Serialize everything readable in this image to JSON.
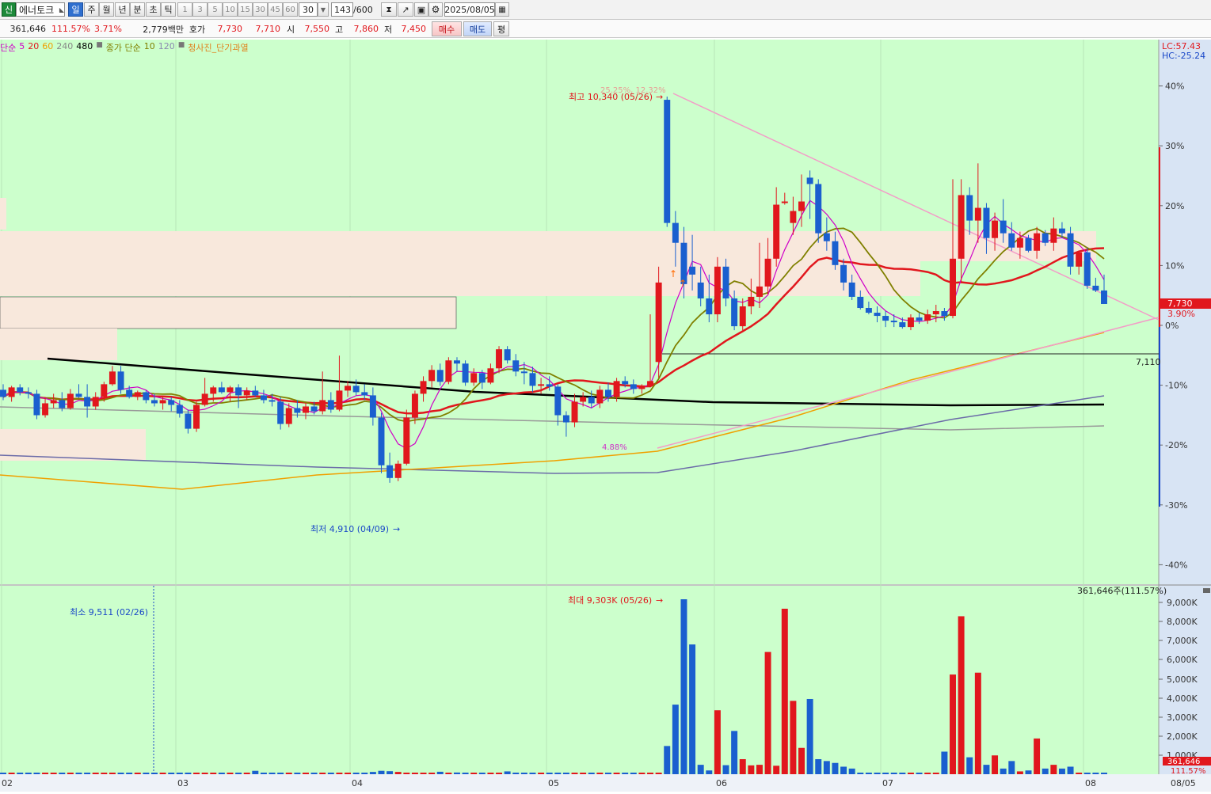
{
  "toolbar": {
    "market_badge": "신",
    "stock_name": "에너토크",
    "periods": [
      "일",
      "주",
      "월",
      "년",
      "분",
      "초",
      "틱"
    ],
    "selected_period": "일",
    "intervals": [
      "1",
      "3",
      "5",
      "10",
      "15",
      "30",
      "45",
      "60"
    ],
    "interval_select": "30",
    "count_value": "143",
    "count_max": "/600",
    "date_value": "2025/08/05"
  },
  "quote": {
    "volume": "361,646",
    "volume_ratio": "111.57%",
    "change_pct": "3.71%",
    "trade_amount": "2,779백만",
    "bid_ask_label": "호가",
    "ask_price": "7,730",
    "bid_price": "7,710",
    "open_label": "시",
    "open": "7,550",
    "high_label": "고",
    "high": "7,860",
    "low_label": "저",
    "low": "7,450",
    "buy_label": "매수",
    "sell_label": "매도",
    "eval_label": "평"
  },
  "indicators": {
    "ma_label": "단순",
    "ma5": "5",
    "ma20": "20",
    "ma60": "60",
    "ma240": "240",
    "ma480": "480",
    "close_ma_label": "종가 단순",
    "close_ma10": "10",
    "close_ma120": "120",
    "signal_label": "청사진_단기과열",
    "colors": {
      "ma5": "#d000c8",
      "ma20": "#e1171d",
      "ma60": "#f0a000",
      "ma240": "#888888",
      "ma480": "#000000",
      "close10": "#808000",
      "close120": "#8a8ab0"
    }
  },
  "chart_data": {
    "type": "candlestick",
    "price_axis": {
      "lc_label": "LC:57.43",
      "hc_label": "HC:-25.24",
      "ticks": [
        "40%",
        "30%",
        "20%",
        "10%",
        "0%",
        "-10%",
        "-20%",
        "-30%",
        "-40%"
      ]
    },
    "x_labels": [
      "02",
      "03",
      "04",
      "05",
      "06",
      "07",
      "08",
      "08/05"
    ],
    "annotations": {
      "highest": "최고 10,340 (05/26)",
      "lowest": "최저 4,910 (04/09)",
      "high_pct": "25.25%, 12.32%",
      "low_pct": "4.88%",
      "support_price": "7,110",
      "current_price": "7,730",
      "current_pct": "3.90%"
    },
    "volume_axis": {
      "ticks": [
        "9,000K",
        "8,000K",
        "7,000K",
        "6,000K",
        "5,000K",
        "4,000K",
        "3,000K",
        "2,000K",
        "1,000K"
      ]
    },
    "volume_annotations": {
      "max": "최대 9,303K (05/26)",
      "min": "최소 9,511 (02/26)",
      "current": "361,646주(111.57%)",
      "current_badge": "361,646",
      "current_pct_badge": "111.57%"
    },
    "candles": [
      {
        "o": 6650,
        "h": 6720,
        "l": 6520,
        "c": 6560
      },
      {
        "o": 6560,
        "h": 6700,
        "l": 6500,
        "c": 6680
      },
      {
        "o": 6680,
        "h": 6720,
        "l": 6580,
        "c": 6620
      },
      {
        "o": 6620,
        "h": 6680,
        "l": 6540,
        "c": 6600
      },
      {
        "o": 6600,
        "h": 6650,
        "l": 6280,
        "c": 6330
      },
      {
        "o": 6330,
        "h": 6560,
        "l": 6300,
        "c": 6480
      },
      {
        "o": 6480,
        "h": 6600,
        "l": 6420,
        "c": 6520
      },
      {
        "o": 6520,
        "h": 6620,
        "l": 6380,
        "c": 6420
      },
      {
        "o": 6420,
        "h": 6660,
        "l": 6400,
        "c": 6600
      },
      {
        "o": 6600,
        "h": 6720,
        "l": 6550,
        "c": 6560
      },
      {
        "o": 6560,
        "h": 6720,
        "l": 6300,
        "c": 6440
      },
      {
        "o": 6440,
        "h": 6620,
        "l": 6400,
        "c": 6560
      },
      {
        "o": 6560,
        "h": 6750,
        "l": 6500,
        "c": 6720
      },
      {
        "o": 6720,
        "h": 6950,
        "l": 6700,
        "c": 6880
      },
      {
        "o": 6880,
        "h": 6950,
        "l": 6600,
        "c": 6650
      },
      {
        "o": 6650,
        "h": 6700,
        "l": 6540,
        "c": 6560
      },
      {
        "o": 6560,
        "h": 6640,
        "l": 6520,
        "c": 6620
      },
      {
        "o": 6620,
        "h": 6640,
        "l": 6480,
        "c": 6520
      },
      {
        "o": 6520,
        "h": 6600,
        "l": 6440,
        "c": 6480
      },
      {
        "o": 6480,
        "h": 6560,
        "l": 6400,
        "c": 6520
      },
      {
        "o": 6520,
        "h": 6560,
        "l": 6380,
        "c": 6460
      },
      {
        "o": 6460,
        "h": 6520,
        "l": 6300,
        "c": 6350
      },
      {
        "o": 6350,
        "h": 6400,
        "l": 6100,
        "c": 6160
      },
      {
        "o": 6160,
        "h": 6500,
        "l": 6120,
        "c": 6460
      },
      {
        "o": 6460,
        "h": 6800,
        "l": 6440,
        "c": 6600
      },
      {
        "o": 6600,
        "h": 6700,
        "l": 6500,
        "c": 6680
      },
      {
        "o": 6680,
        "h": 6750,
        "l": 6600,
        "c": 6620
      },
      {
        "o": 6620,
        "h": 6700,
        "l": 6500,
        "c": 6680
      },
      {
        "o": 6680,
        "h": 6720,
        "l": 6420,
        "c": 6580
      },
      {
        "o": 6580,
        "h": 6680,
        "l": 6520,
        "c": 6640
      },
      {
        "o": 6640,
        "h": 6700,
        "l": 6560,
        "c": 6580
      },
      {
        "o": 6580,
        "h": 6650,
        "l": 6480,
        "c": 6520
      },
      {
        "o": 6520,
        "h": 6600,
        "l": 6440,
        "c": 6500
      },
      {
        "o": 6500,
        "h": 6560,
        "l": 6150,
        "c": 6220
      },
      {
        "o": 6220,
        "h": 6480,
        "l": 6180,
        "c": 6420
      },
      {
        "o": 6420,
        "h": 6520,
        "l": 6300,
        "c": 6360
      },
      {
        "o": 6360,
        "h": 6480,
        "l": 6280,
        "c": 6440
      },
      {
        "o": 6440,
        "h": 6500,
        "l": 6340,
        "c": 6380
      },
      {
        "o": 6380,
        "h": 6880,
        "l": 6340,
        "c": 6520
      },
      {
        "o": 6520,
        "h": 6620,
        "l": 6360,
        "c": 6400
      },
      {
        "o": 6400,
        "h": 7080,
        "l": 6380,
        "c": 6640
      },
      {
        "o": 6640,
        "h": 6760,
        "l": 6560,
        "c": 6700
      },
      {
        "o": 6700,
        "h": 6780,
        "l": 6580,
        "c": 6620
      },
      {
        "o": 6620,
        "h": 6720,
        "l": 6520,
        "c": 6580
      },
      {
        "o": 6580,
        "h": 6680,
        "l": 6200,
        "c": 6300
      },
      {
        "o": 6300,
        "h": 6360,
        "l": 5600,
        "c": 5700
      },
      {
        "o": 5700,
        "h": 5860,
        "l": 5480,
        "c": 5540
      },
      {
        "o": 5540,
        "h": 5760,
        "l": 5500,
        "c": 5720
      },
      {
        "o": 5720,
        "h": 6400,
        "l": 5700,
        "c": 6300
      },
      {
        "o": 6300,
        "h": 6640,
        "l": 6220,
        "c": 6600
      },
      {
        "o": 6600,
        "h": 6820,
        "l": 6500,
        "c": 6760
      },
      {
        "o": 6760,
        "h": 6960,
        "l": 6680,
        "c": 6900
      },
      {
        "o": 6900,
        "h": 6980,
        "l": 6700,
        "c": 6750
      },
      {
        "o": 6750,
        "h": 7060,
        "l": 6720,
        "c": 7020
      },
      {
        "o": 7020,
        "h": 7060,
        "l": 6880,
        "c": 6980
      },
      {
        "o": 6980,
        "h": 7020,
        "l": 6700,
        "c": 6740
      },
      {
        "o": 6740,
        "h": 6920,
        "l": 6700,
        "c": 6860
      },
      {
        "o": 6860,
        "h": 6900,
        "l": 6660,
        "c": 6740
      },
      {
        "o": 6740,
        "h": 6980,
        "l": 6720,
        "c": 6920
      },
      {
        "o": 6920,
        "h": 7200,
        "l": 6860,
        "c": 7160
      },
      {
        "o": 7160,
        "h": 7200,
        "l": 6980,
        "c": 7020
      },
      {
        "o": 7020,
        "h": 7100,
        "l": 6820,
        "c": 6880
      },
      {
        "o": 6880,
        "h": 7000,
        "l": 6720,
        "c": 6860
      },
      {
        "o": 6860,
        "h": 6940,
        "l": 6620,
        "c": 6700
      },
      {
        "o": 6700,
        "h": 6800,
        "l": 6600,
        "c": 6720
      },
      {
        "o": 6720,
        "h": 6820,
        "l": 6640,
        "c": 6690
      },
      {
        "o": 6690,
        "h": 6720,
        "l": 6200,
        "c": 6330
      },
      {
        "o": 6330,
        "h": 6380,
        "l": 6060,
        "c": 6240
      },
      {
        "o": 6240,
        "h": 6600,
        "l": 6180,
        "c": 6500
      },
      {
        "o": 6500,
        "h": 6620,
        "l": 6440,
        "c": 6560
      },
      {
        "o": 6560,
        "h": 6640,
        "l": 6420,
        "c": 6480
      },
      {
        "o": 6480,
        "h": 6700,
        "l": 6420,
        "c": 6650
      },
      {
        "o": 6650,
        "h": 6740,
        "l": 6500,
        "c": 6560
      },
      {
        "o": 6560,
        "h": 6800,
        "l": 6500,
        "c": 6760
      },
      {
        "o": 6760,
        "h": 6820,
        "l": 6680,
        "c": 6720
      },
      {
        "o": 6720,
        "h": 6780,
        "l": 6600,
        "c": 6660
      },
      {
        "o": 6660,
        "h": 6720,
        "l": 6600,
        "c": 6700
      },
      {
        "o": 6700,
        "h": 7600,
        "l": 6680,
        "c": 6760
      },
      {
        "o": 7000,
        "h": 8200,
        "l": 6800,
        "c": 8000
      },
      {
        "o": 10300,
        "h": 10340,
        "l": 8700,
        "c": 8750
      },
      {
        "o": 8750,
        "h": 8900,
        "l": 8200,
        "c": 8500
      },
      {
        "o": 8500,
        "h": 8700,
        "l": 7800,
        "c": 7980
      },
      {
        "o": 8200,
        "h": 8600,
        "l": 7900,
        "c": 8100
      },
      {
        "o": 8000,
        "h": 8200,
        "l": 7700,
        "c": 7800
      },
      {
        "o": 7800,
        "h": 8100,
        "l": 7500,
        "c": 7600
      },
      {
        "o": 7600,
        "h": 8320,
        "l": 7500,
        "c": 8200
      },
      {
        "o": 8200,
        "h": 8300,
        "l": 7700,
        "c": 7800
      },
      {
        "o": 7800,
        "h": 7900,
        "l": 7400,
        "c": 7450
      },
      {
        "o": 7450,
        "h": 7800,
        "l": 7400,
        "c": 7700
      },
      {
        "o": 7700,
        "h": 8050,
        "l": 7600,
        "c": 7820
      },
      {
        "o": 7820,
        "h": 8500,
        "l": 7680,
        "c": 7950
      },
      {
        "o": 7950,
        "h": 8560,
        "l": 7850,
        "c": 8300
      },
      {
        "o": 8300,
        "h": 9200,
        "l": 8200,
        "c": 8980
      },
      {
        "o": 9000,
        "h": 9130,
        "l": 8980,
        "c": 9020
      },
      {
        "o": 8750,
        "h": 9080,
        "l": 8600,
        "c": 8900
      },
      {
        "o": 8900,
        "h": 9360,
        "l": 8700,
        "c": 9020
      },
      {
        "o": 9320,
        "h": 9410,
        "l": 8800,
        "c": 9240
      },
      {
        "o": 9240,
        "h": 9300,
        "l": 8500,
        "c": 8620
      },
      {
        "o": 8620,
        "h": 8820,
        "l": 8400,
        "c": 8520
      },
      {
        "o": 8520,
        "h": 8640,
        "l": 8160,
        "c": 8220
      },
      {
        "o": 8220,
        "h": 8300,
        "l": 7900,
        "c": 8000
      },
      {
        "o": 8000,
        "h": 8100,
        "l": 7780,
        "c": 7820
      },
      {
        "o": 7820,
        "h": 7900,
        "l": 7660,
        "c": 7680
      },
      {
        "o": 7680,
        "h": 7760,
        "l": 7600,
        "c": 7620
      },
      {
        "o": 7620,
        "h": 7700,
        "l": 7500,
        "c": 7580
      },
      {
        "o": 7580,
        "h": 7640,
        "l": 7440,
        "c": 7520
      },
      {
        "o": 7520,
        "h": 7600,
        "l": 7440,
        "c": 7500
      },
      {
        "o": 7500,
        "h": 7560,
        "l": 7420,
        "c": 7440
      },
      {
        "o": 7440,
        "h": 7600,
        "l": 7400,
        "c": 7560
      },
      {
        "o": 7560,
        "h": 7620,
        "l": 7480,
        "c": 7520
      },
      {
        "o": 7520,
        "h": 7660,
        "l": 7480,
        "c": 7600
      },
      {
        "o": 7600,
        "h": 7720,
        "l": 7500,
        "c": 7640
      },
      {
        "o": 7640,
        "h": 7680,
        "l": 7520,
        "c": 7580
      },
      {
        "o": 7580,
        "h": 9300,
        "l": 7550,
        "c": 8300
      },
      {
        "o": 8300,
        "h": 9300,
        "l": 8000,
        "c": 9100
      },
      {
        "o": 9100,
        "h": 9200,
        "l": 8600,
        "c": 8780
      },
      {
        "o": 8780,
        "h": 9500,
        "l": 8500,
        "c": 8940
      },
      {
        "o": 8940,
        "h": 9000,
        "l": 8360,
        "c": 8560
      },
      {
        "o": 8560,
        "h": 8880,
        "l": 8400,
        "c": 8780
      },
      {
        "o": 8780,
        "h": 9050,
        "l": 8500,
        "c": 8620
      },
      {
        "o": 8620,
        "h": 8760,
        "l": 8400,
        "c": 8440
      },
      {
        "o": 8440,
        "h": 8640,
        "l": 8300,
        "c": 8560
      },
      {
        "o": 8560,
        "h": 8600,
        "l": 8380,
        "c": 8400
      },
      {
        "o": 8400,
        "h": 8700,
        "l": 8300,
        "c": 8620
      },
      {
        "o": 8620,
        "h": 8660,
        "l": 8460,
        "c": 8500
      },
      {
        "o": 8500,
        "h": 8820,
        "l": 8400,
        "c": 8680
      },
      {
        "o": 8680,
        "h": 8760,
        "l": 8560,
        "c": 8620
      },
      {
        "o": 8620,
        "h": 8700,
        "l": 8100,
        "c": 8200
      },
      {
        "o": 8200,
        "h": 8400,
        "l": 8100,
        "c": 8380
      },
      {
        "o": 8380,
        "h": 8440,
        "l": 7920,
        "c": 7960
      },
      {
        "o": 7960,
        "h": 8060,
        "l": 7880,
        "c": 7900
      },
      {
        "o": 7900,
        "h": 8100,
        "l": 7860,
        "c": 7730
      }
    ]
  }
}
